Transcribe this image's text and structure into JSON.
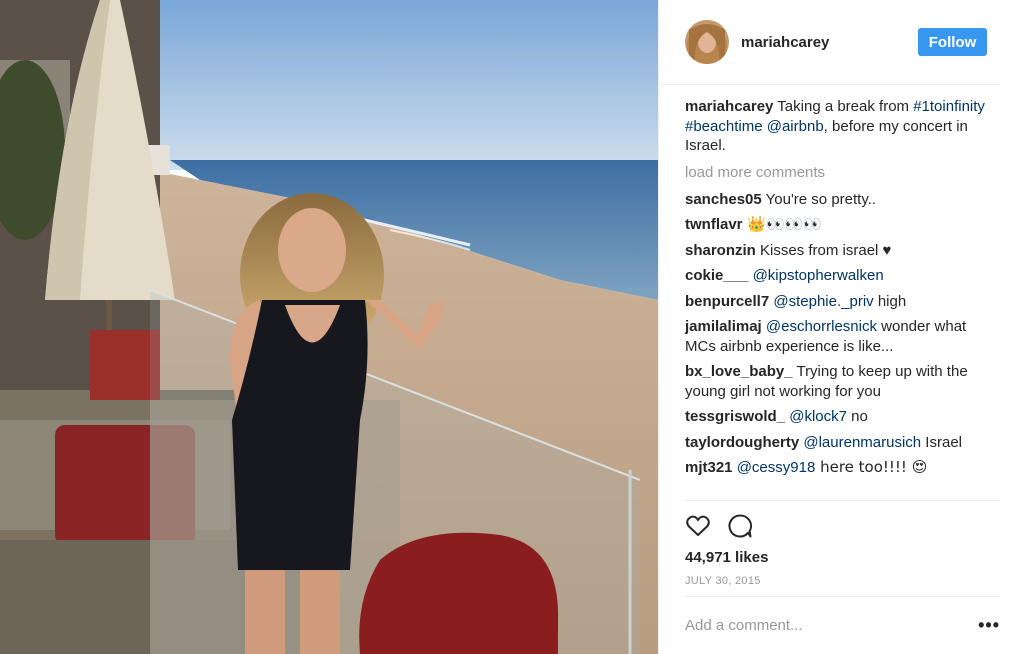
{
  "post": {
    "username": "mariahcarey",
    "follow_label": "Follow",
    "caption": {
      "username": "mariahcarey",
      "text_a": " Taking a break from ",
      "tag1": "#1toinfinity",
      "text_b": " ",
      "tag2": "#beachtime",
      "text_c": " ",
      "mention": "@airbnb",
      "text_d": ", before my concert in Israel."
    },
    "load_more": "load more comments",
    "comments": [
      {
        "user": "sanches05",
        "text": " You're so pretty.."
      },
      {
        "user": "twnflavr",
        "text": " 👑👀👀👀"
      },
      {
        "user": "sharonzin",
        "text": " Kisses from israel ♥"
      },
      {
        "user": "cokie___",
        "mention": "@kipstopherwalken",
        "pre": " ",
        "text": ""
      },
      {
        "user": "benpurcell7",
        "pre": " ",
        "mention": "@stephie._priv",
        "text": " high"
      },
      {
        "user": "jamilalimaj",
        "pre": " ",
        "mention": "@eschorrlesnick",
        "text": " wonder what MCs airbnb experience is like..."
      },
      {
        "user": "bx_love_baby_",
        "text": " Trying to keep up with the young girl not working for you"
      },
      {
        "user": "tessgriswold_",
        "pre": " ",
        "mention": "@klock7",
        "text": " no"
      },
      {
        "user": "taylordougherty",
        "pre": " ",
        "mention": "@laurenmarusich",
        "text": " Israel"
      },
      {
        "user": "mjt321",
        "pre": " ",
        "mention": "@cessy918",
        "text": " here too!!!! 😍"
      }
    ],
    "likes": "44,971 likes",
    "date": "JULY 30, 2015",
    "add_comment_placeholder": "Add a comment...",
    "more_label": "•••",
    "icons": {
      "like": "heart-outline-icon",
      "comment": "speech-bubble-icon",
      "more": "ellipsis-icon"
    }
  }
}
